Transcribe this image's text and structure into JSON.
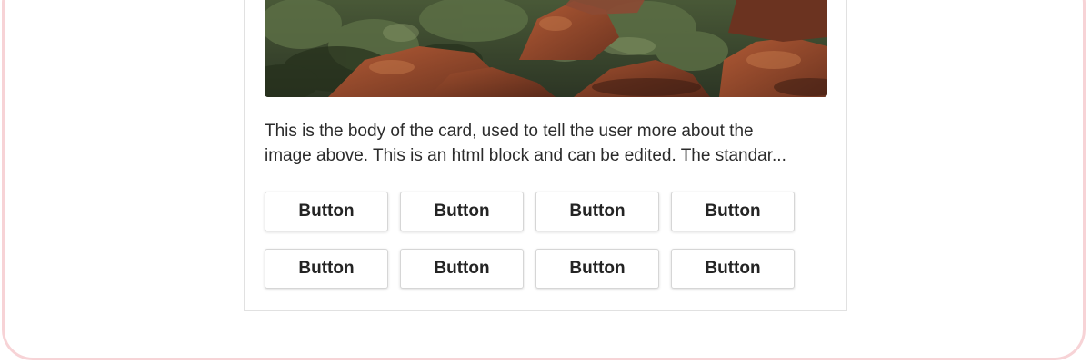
{
  "card": {
    "image": {
      "alt": "",
      "colors": {
        "foliage": "#3e5230",
        "rock": "#9a4a2c",
        "shadow": "#2a2d22"
      }
    },
    "body": {
      "line1": "This is the body of the card, used to tell the user more about the",
      "line2": "image above. This is an html block and can be edited. The standar..."
    },
    "buttons": [
      {
        "label": "Button"
      },
      {
        "label": "Button"
      },
      {
        "label": "Button"
      },
      {
        "label": "Button"
      },
      {
        "label": "Button"
      },
      {
        "label": "Button"
      },
      {
        "label": "Button"
      },
      {
        "label": "Button"
      }
    ]
  },
  "frame": {
    "border_color": "#f7d3d6"
  }
}
